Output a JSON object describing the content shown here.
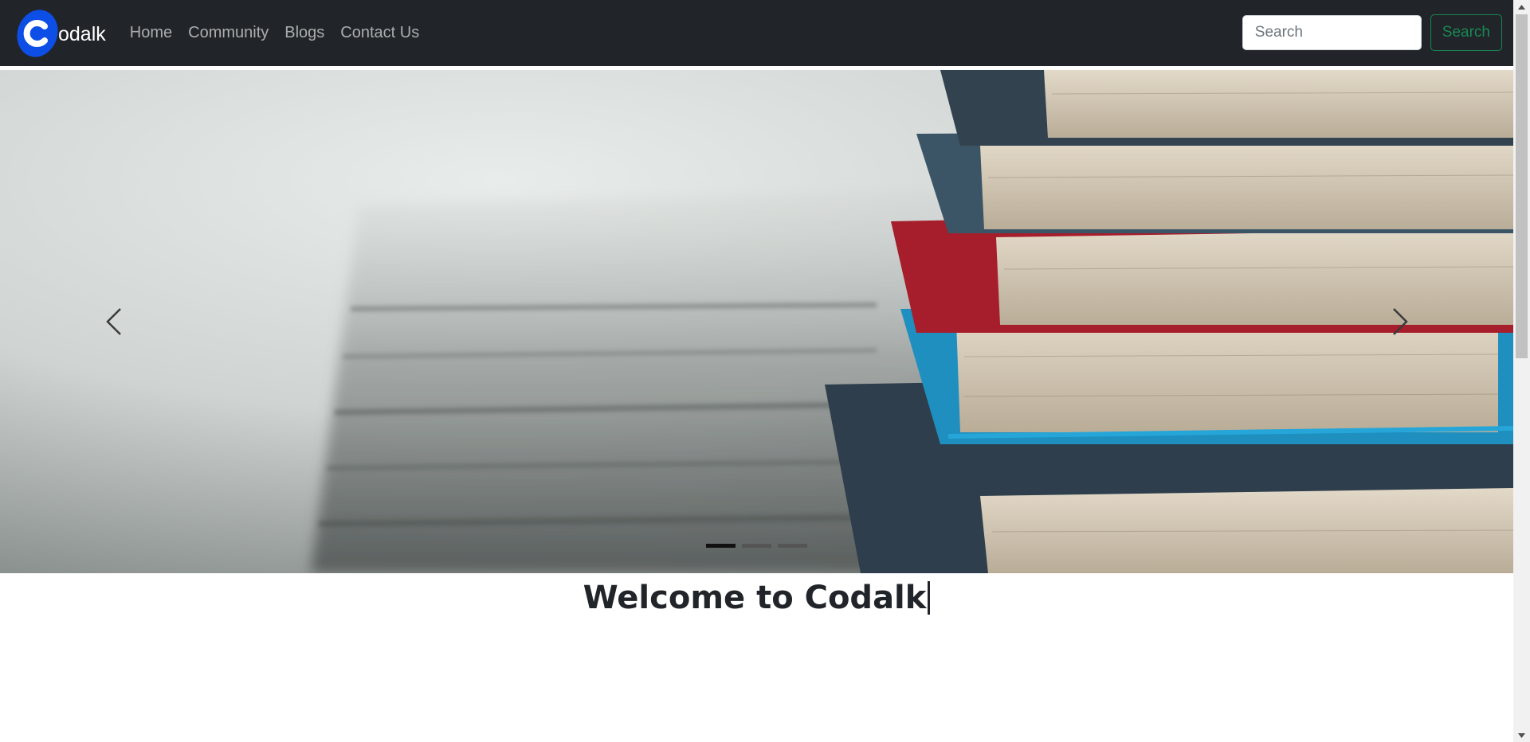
{
  "navbar": {
    "brand_text": "odalk",
    "links": [
      "Home",
      "Community",
      "Blogs",
      "Contact Us"
    ],
    "search": {
      "placeholder": "Search",
      "value": "",
      "button_label": "Search"
    },
    "colors": {
      "background": "#212529",
      "search_button": "#198754",
      "logo": "#0d4fe6"
    }
  },
  "carousel": {
    "slide_count": 3,
    "active_index": 0,
    "prev_icon": "chevron-left-icon",
    "next_icon": "chevron-right-icon"
  },
  "main": {
    "heading": "Welcome to Codalk"
  }
}
